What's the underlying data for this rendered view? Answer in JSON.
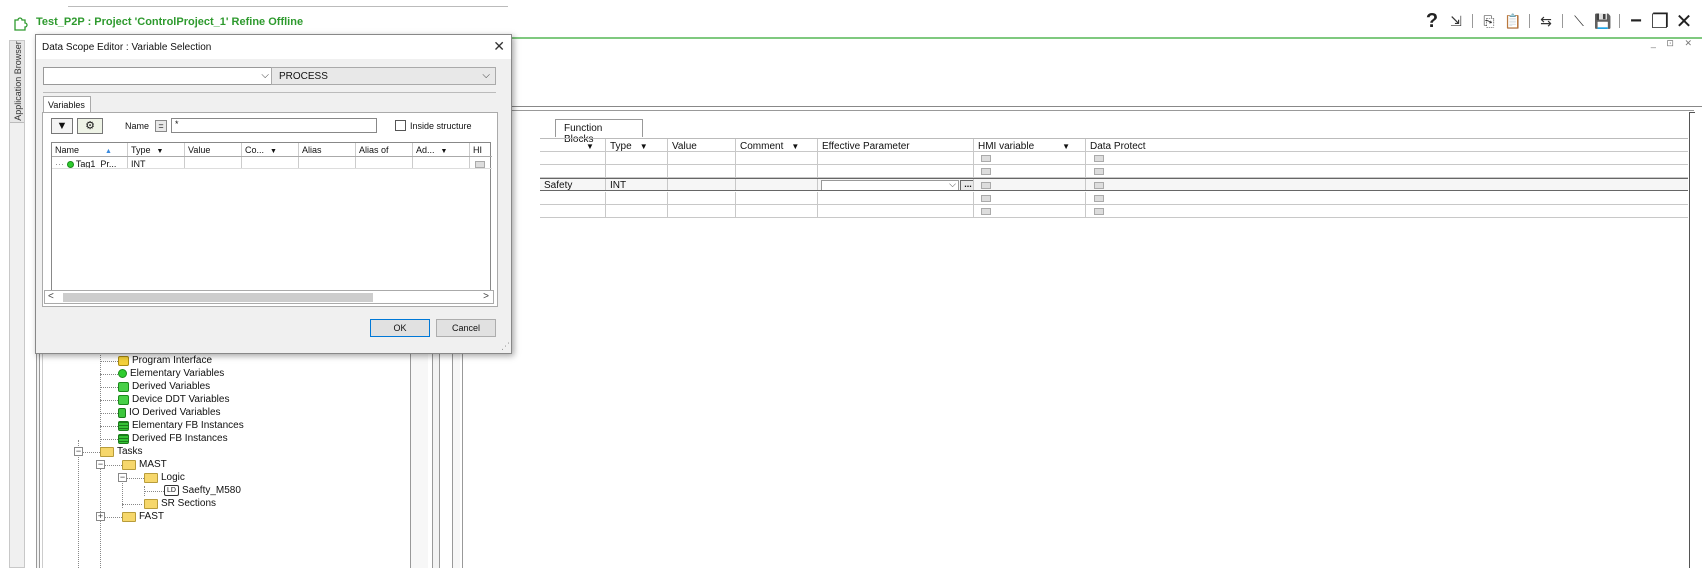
{
  "window": {
    "title": "Test_P2P : Project 'ControlProject_1' Refine Offline",
    "app_icon": "puzzle-icon",
    "toolbar_icons": [
      "help-icon",
      "restore-arrow-icon",
      "copy-icon",
      "paste-icon",
      "connect-icon",
      "disconnect-icon",
      "save-icon",
      "minimize-icon",
      "restore-icon",
      "close-icon"
    ],
    "toolbar_glyphs": [
      "?",
      "⇲",
      "⎘",
      "📋",
      "⇆",
      "⟍",
      "💾",
      "−",
      "❐",
      "✕"
    ],
    "mdi_controls": "_ ⊡ ✕"
  },
  "side_strip": {
    "label": "Application Browser"
  },
  "tree": {
    "items": [
      {
        "label": "Program Interface",
        "icon": "program-interface-icon"
      },
      {
        "label": "Elementary Variables",
        "icon": "elementary-variables-icon"
      },
      {
        "label": "Derived Variables",
        "icon": "derived-variables-icon"
      },
      {
        "label": "Device DDT Variables",
        "icon": "device-ddt-variables-icon"
      },
      {
        "label": "IO Derived Variables",
        "icon": "io-derived-variables-icon"
      },
      {
        "label": "Elementary FB Instances",
        "icon": "elementary-fb-instances-icon"
      },
      {
        "label": "Derived FB Instances",
        "icon": "derived-fb-instances-icon"
      },
      {
        "label": "Tasks",
        "icon": "folder-open-icon"
      },
      {
        "label": "MAST",
        "icon": "folder-open-icon"
      },
      {
        "label": "Logic",
        "icon": "folder-open-icon"
      },
      {
        "label": "Saefty_M580",
        "icon": "ld-section-icon"
      },
      {
        "label": "SR Sections",
        "icon": "folder-icon"
      },
      {
        "label": "FAST",
        "icon": "folder-icon"
      }
    ]
  },
  "editor": {
    "tab": "Function Blocks",
    "columns": [
      {
        "label": "",
        "arrow": "▼"
      },
      {
        "label": "Type",
        "arrow": "▼"
      },
      {
        "label": "Value",
        "arrow": ""
      },
      {
        "label": "Comment",
        "arrow": "▼"
      },
      {
        "label": "Effective Parameter",
        "arrow": ""
      },
      {
        "label": "HMI variable",
        "arrow": "▼"
      },
      {
        "label": "Data Protect",
        "arrow": ""
      }
    ],
    "rows": [
      {
        "name": "",
        "type": "",
        "selected": false
      },
      {
        "name": "",
        "type": "",
        "selected": false
      },
      {
        "name": "Safety",
        "type": "INT",
        "selected": true
      },
      {
        "name": "",
        "type": "",
        "selected": false
      },
      {
        "name": "",
        "type": "",
        "selected": false
      }
    ],
    "effective_param_button": "..."
  },
  "dialog": {
    "title": "Data Scope Editor : Variable Selection",
    "close": "✕",
    "scope_combo_value": "",
    "process_combo_value": "PROCESS",
    "tab": "Variables",
    "filter_icon": "filter-icon",
    "settings_icon": "filter-settings-icon",
    "name_label": "Name",
    "eq_label": "=",
    "name_filter": "*",
    "inside_structure_label": "Inside structure",
    "columns": [
      {
        "label": "Name",
        "arrow": "▲"
      },
      {
        "label": "Type",
        "arrow": "▼"
      },
      {
        "label": "Value",
        "arrow": ""
      },
      {
        "label": "Co...",
        "arrow": "▼"
      },
      {
        "label": "Alias",
        "arrow": ""
      },
      {
        "label": "Alias of",
        "arrow": ""
      },
      {
        "label": "Ad...",
        "arrow": "▼"
      },
      {
        "label": "HI",
        "arrow": ""
      }
    ],
    "row": {
      "name": "Tag1_Pr...",
      "type": "INT"
    },
    "scroll_left": "<",
    "scroll_right": ">",
    "ok_label": "OK",
    "cancel_label": "Cancel"
  }
}
